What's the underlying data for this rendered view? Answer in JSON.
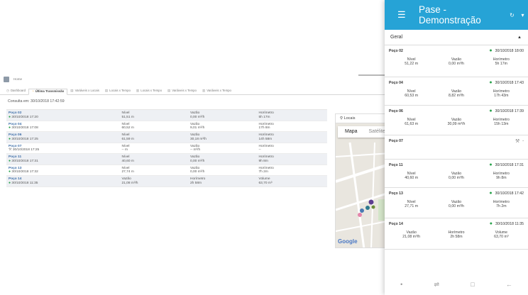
{
  "desktop": {
    "breadcrumb": "Home",
    "tabs": [
      {
        "label": "Dashboard",
        "active": false,
        "icon": "dashboard-icon"
      },
      {
        "label": "Última Transmissão",
        "active": true,
        "icon": "clock-icon"
      },
      {
        "label": "Variáveis x Locais",
        "active": false,
        "icon": "table-icon"
      },
      {
        "label": "Locais x Tempo",
        "active": false,
        "icon": "table-icon"
      },
      {
        "label": "Locais x Tempo",
        "active": false,
        "icon": "chart-icon"
      },
      {
        "label": "Variáveis x Tempo",
        "active": false,
        "icon": "table-icon"
      },
      {
        "label": "Variáveis x Tempo",
        "active": false,
        "icon": "chart-icon"
      }
    ],
    "consulta": "Consulta em: 30/10/2018 17:42:59",
    "rows": [
      {
        "name": "Poço 02",
        "date": "30/10/2018 17:20",
        "status": "ok",
        "c2l": "Nível",
        "c2v": "51,51 m",
        "c3l": "Vazão",
        "c3v": "0,00 m³/h",
        "c4l": "Horímetro",
        "c4v": "5h 17m"
      },
      {
        "name": "Poço 04",
        "date": "30/10/2018 17:08",
        "status": "ok",
        "c2l": "Nível",
        "c2v": "60,52 m",
        "c3l": "Vazão",
        "c3v": "9,01 m³/h",
        "c4l": "Horímetro",
        "c4v": "17h 8m"
      },
      {
        "name": "Poço 06",
        "date": "30/10/2018 17:25",
        "status": "ok",
        "c2l": "Nível",
        "c2v": "61,59 m",
        "c3l": "Vazão",
        "c3v": "30,18 m³/h",
        "c4l": "Horímetro",
        "c4v": "14h 58m"
      },
      {
        "name": "Poço 07",
        "date": "30/10/2018 17:25",
        "status": "warn",
        "c2l": "Nível",
        "c2v": "-- m",
        "c3l": "Vazão",
        "c3v": "-- m³/h",
        "c4l": "Horímetro",
        "c4v": "--"
      },
      {
        "name": "Poço 11",
        "date": "30/10/2018 17:31",
        "status": "ok",
        "c2l": "Nível",
        "c2v": "40,60 m",
        "c3l": "Vazão",
        "c3v": "0,00 m³/h",
        "c4l": "Horímetro",
        "c4v": "9h 8m"
      },
      {
        "name": "Poço 13",
        "date": "30/10/2018 17:32",
        "status": "ok",
        "c2l": "Nível",
        "c2v": "27,74 m",
        "c3l": "Vazão",
        "c3v": "0,00 m³/h",
        "c4l": "Horímetro",
        "c4v": "7h 2m"
      },
      {
        "name": "Poço 14",
        "date": "30/10/2018 11:35",
        "status": "ok",
        "c2l": "Vazão",
        "c2v": "21,08 m³/h",
        "c3l": "Horímetro",
        "c3v": "2h 58m",
        "c4l": "Volume",
        "c4v": "63,70 m³"
      }
    ],
    "map": {
      "search": "Locais",
      "tab_map": "Mapa",
      "tab_sat": "Satélite",
      "brand": "Google"
    }
  },
  "phone": {
    "title": "Pase - Demonstração",
    "group": "Geral",
    "cards": [
      {
        "name": "Poço 02",
        "status": "ok",
        "date": "30/10/2018 18:00",
        "vals": [
          [
            "Nível",
            "51,22 m"
          ],
          [
            "Vazão",
            "0,00 m³/h"
          ],
          [
            "Horímetro",
            "5h 17m"
          ]
        ]
      },
      {
        "name": "Poço 04",
        "status": "ok",
        "date": "30/10/2018 17:43",
        "vals": [
          [
            "Nível",
            "60,53 m"
          ],
          [
            "Vazão",
            "8,82 m³/h"
          ],
          [
            "Horímetro",
            "17h 43m"
          ]
        ]
      },
      {
        "name": "Poço 06",
        "status": "ok",
        "date": "30/10/2018 17:39",
        "vals": [
          [
            "Nível",
            "61,63 m"
          ],
          [
            "Vazão",
            "30,09 m³/h"
          ],
          [
            "Horímetro",
            "15h 13m"
          ]
        ]
      },
      {
        "name": "Poço 07",
        "status": "warn",
        "date": "-",
        "vals": []
      },
      {
        "name": "Poço 11",
        "status": "ok",
        "date": "30/10/2018 17:31",
        "vals": [
          [
            "Nível",
            "40,60 m"
          ],
          [
            "Vazão",
            "0,00 m³/h"
          ],
          [
            "Horímetro",
            "9h 8m"
          ]
        ]
      },
      {
        "name": "Poço 13",
        "status": "ok",
        "date": "30/10/2018 17:42",
        "vals": [
          [
            "Nível",
            "27,71 m"
          ],
          [
            "Vazão",
            "0,00 m³/h"
          ],
          [
            "Horímetro",
            "7h 2m"
          ]
        ]
      },
      {
        "name": "Poço 14",
        "status": "ok",
        "date": "30/10/2018 11:35",
        "vals": [
          [
            "Vazão",
            "21,08 m³/h"
          ],
          [
            "Horímetro",
            "2h 58m"
          ],
          [
            "Volume",
            "63,70 m³"
          ]
        ]
      }
    ]
  }
}
